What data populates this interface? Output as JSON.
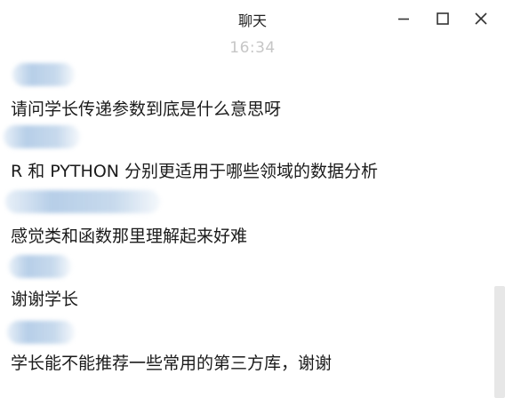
{
  "window": {
    "title": "聊天",
    "controls": {
      "minimize_icon": "minimize-icon",
      "maximize_icon": "maximize-icon",
      "close_icon": "close-icon"
    }
  },
  "chat": {
    "timestamp": "16:34",
    "messages": [
      {
        "text": "请问学长传递参数到底是什么意思呀"
      },
      {
        "text": "R  和 PYTHON  分别更适用于哪些领域的数据分析"
      },
      {
        "text": "感觉类和函数那里理解起来好难"
      },
      {
        "text": "谢谢学长"
      },
      {
        "text": "学长能不能推荐一些常用的第三方库，谢谢"
      }
    ]
  },
  "colors": {
    "timestamp": "#c6c6c6",
    "text": "#1b1b1b",
    "blurred_name": "#b3cbe6"
  }
}
